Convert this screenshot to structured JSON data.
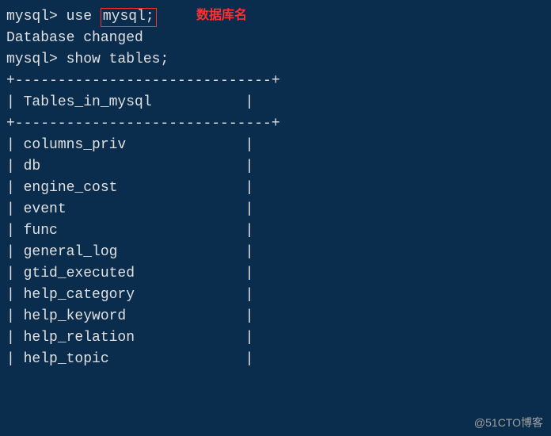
{
  "terminal": {
    "prompt": "mysql>",
    "cmd_use_pre": "use ",
    "cmd_use_boxed": "mysql;",
    "annotation": "数据库名",
    "response_use": "Database changed",
    "cmd_show": "show tables;",
    "table_border": "+------------------------------+",
    "table_header": "Tables_in_mysql",
    "rows": [
      "columns_priv",
      "db",
      "engine_cost",
      "event",
      "func",
      "general_log",
      "gtid_executed",
      "help_category",
      "help_keyword",
      "help_relation",
      "help_topic"
    ]
  },
  "watermark": "@51CTO博客"
}
